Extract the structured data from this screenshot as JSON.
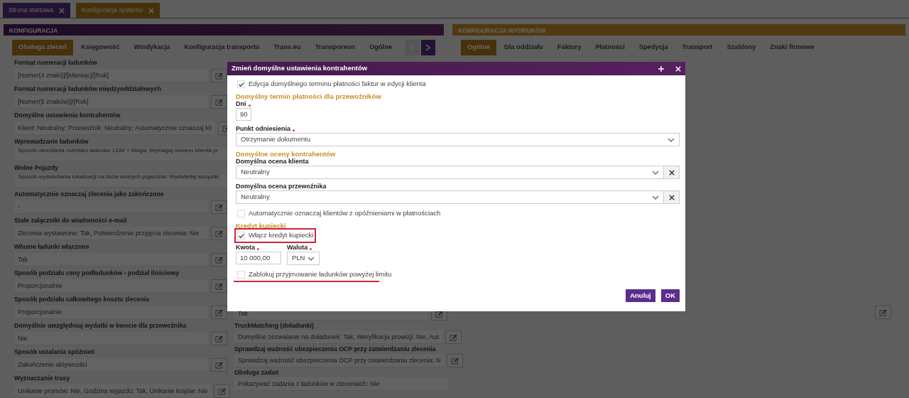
{
  "top_tabs": [
    {
      "label": "Strona startowa",
      "selected": false
    },
    {
      "label": "Konfiguracja systemu",
      "selected": true
    }
  ],
  "left_panel": {
    "title": "KONFIGURACJA",
    "tabs": [
      {
        "label": "Obsługa zleceń",
        "selected": true
      },
      {
        "label": "Księgowość",
        "selected": false
      },
      {
        "label": "Windykacja",
        "selected": false
      },
      {
        "label": "Konfiguracja transportu",
        "selected": false
      },
      {
        "label": "Trans.eu",
        "selected": false
      },
      {
        "label": "Transporeon",
        "selected": false
      },
      {
        "label": "Ogólne",
        "selected": false
      }
    ],
    "pager": {
      "prev_disabled": true,
      "next_disabled": false
    },
    "columns": [
      [
        {
          "label": "Format numeracji ładunków",
          "value": "[Numer(4 znaki)]/[Miesiąc]/[Rok]",
          "editable": true
        },
        {
          "label": "Format numeracji ładunków międzyoddziałowych",
          "value": "[Numer(5 znaków)]/[Rok]",
          "editable": true
        },
        {
          "label": "Domyślne ustawienia kontrahentów",
          "value": "Klient: Neutralny; Przewoźnik: Neutralny; Automatycznie oznaczaj kli",
          "editable": true
        },
        {
          "label": "Wprowadzanie ładunków",
          "value": "Sposób określania rozmiaru ładunku: LDM + Waga; Wymagaj numeru klienta pr",
          "editable": false
        },
        {
          "label": "Wolne Pojazdy",
          "value": "Sposób wyświetlania lokalizacji na liście wolnych pojazdów: Wyświetlaj wszystki",
          "editable": false
        },
        {
          "label": "Automatycznie oznaczaj zlecenia jako zakończone",
          "value": "-",
          "editable": true
        },
        {
          "label": "Stałe załączniki do wiadomości e-mail",
          "value": "Zlecenia wystawione: Tak, Potwierdzenie przyjęcia zlecenia: Nie",
          "editable": true
        },
        {
          "label": "Własne ładunki włączone",
          "value": "Tak",
          "editable": true
        },
        {
          "label": "Sposób podziału ceny podładunków - podział ilościowy",
          "value": "Proporcjonalnie",
          "editable": true
        },
        {
          "label": "Sposób podziału całkowitego kosztu zlecenia",
          "value": "Proporcjonalnie",
          "editable": true
        },
        {
          "label": "Domyślnie uwzględniaj wydatki w kwocie dla przewoźnika",
          "value": "Nie",
          "editable": true
        },
        {
          "label": "Sposób ustalania spóźnień",
          "value": "Zakończenie aktywności",
          "editable": true
        },
        {
          "label": "Wyznaczanie trasy",
          "value": "Unikanie promów: Nie, Godzina wyjazdu: Tak, Unikanie krajów: Nie",
          "editable": true
        }
      ],
      [
        {
          "value": "Tak",
          "editable": true
        },
        {
          "label": "TruckMatching (doładunki)",
          "value": "Domyślne zezwalanie na doładunek: Tak, Weryfikacja prowizji: Nie, Aut",
          "editable": true
        },
        {
          "label": "Sprawdzaj ważność ubezpieczenia OCP przy zatwierdzaniu zlecenia",
          "value": "Sprawdzaj ważność ubezpieczenia OCP przy zatwierdzaniu zlecenia: N",
          "editable": true
        },
        {
          "label": "Obsługa zadań",
          "value": "Pokazywać zadania z ładunków w zleceniach: Nie",
          "editable": false
        }
      ]
    ]
  },
  "right_panel": {
    "title": "KONFIGURACJA WYDRUKÓW",
    "tabs": [
      {
        "label": "Ogólne",
        "selected": true
      },
      {
        "label": "Dla oddziału",
        "selected": false
      },
      {
        "label": "Faktury",
        "selected": false
      },
      {
        "label": "Płatności",
        "selected": false
      },
      {
        "label": "Spedycja",
        "selected": false
      },
      {
        "label": "Transport",
        "selected": false
      },
      {
        "label": "Szablony",
        "selected": false
      },
      {
        "label": "Znaki firmowe",
        "selected": false
      }
    ],
    "fields": [
      {
        "editable": true
      }
    ]
  },
  "dialog": {
    "title": "Zmień domyślne ustawienia kontrahentów",
    "items": [
      {
        "kind": "checkbox",
        "label": "Edycja domyślnego terminu płatności faktur w edycji klienta",
        "checked": true,
        "boxed": false,
        "underlined": false
      },
      {
        "kind": "heading",
        "text": "Domyślny termin płatności dla przewoźników"
      },
      {
        "kind": "number",
        "label": "Dni",
        "required": true,
        "value": "90"
      },
      {
        "kind": "select",
        "label": "Punkt odniesienia",
        "required": true,
        "value": "Otrzymanie dokumentu",
        "clearable": false
      },
      {
        "kind": "heading",
        "text": "Domyślne oceny kontrahentów"
      },
      {
        "kind": "select",
        "label": "Domyślna ocena klienta",
        "required": false,
        "value": "Neutralny",
        "clearable": true
      },
      {
        "kind": "select",
        "label": "Domyślna ocena przewoźnika",
        "required": false,
        "value": "Neutralny",
        "clearable": true
      },
      {
        "kind": "checkbox",
        "label": "Automatycznie oznaczaj klientów z opóźnieniami w płatnościach",
        "checked": false,
        "boxed": false,
        "underlined": false
      },
      {
        "kind": "heading",
        "text": "Kredyt kupiecki"
      },
      {
        "kind": "checkbox",
        "label": "Włącz kredyt kupiecki",
        "checked": true,
        "boxed": true,
        "underlined": false
      },
      {
        "kind": "pair",
        "fields": [
          {
            "kind": "input",
            "label": "Kwota",
            "required": true,
            "value": "10 000,00"
          },
          {
            "kind": "select",
            "label": "Waluta",
            "required": true,
            "value": "PLN",
            "clearable": false
          }
        ]
      },
      {
        "kind": "checkbox",
        "label": "Zablokuj przyjmowanie ładunków powyżej limitu",
        "checked": false,
        "boxed": false,
        "underlined": true
      }
    ],
    "buttons": [
      "Anuluj",
      "OK"
    ]
  }
}
